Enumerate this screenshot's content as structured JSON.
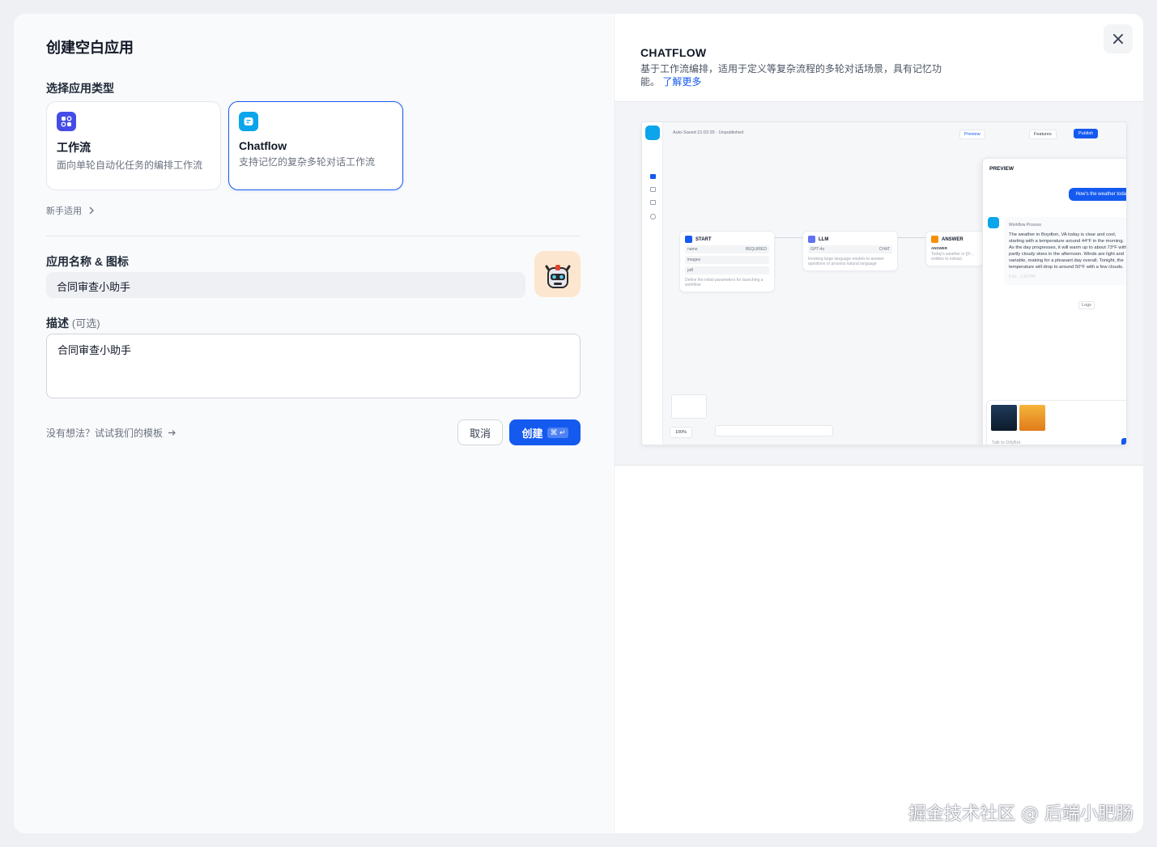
{
  "dialog": {
    "title": "创建空白应用",
    "app_type_label": "选择应用类型",
    "types": [
      {
        "name": "工作流",
        "desc": "面向单轮自动化任务的编排工作流",
        "icon": "workflow-icon",
        "color": "#444ce7"
      },
      {
        "name": "Chatflow",
        "desc": "支持记忆的复杂多轮对话工作流",
        "icon": "chatflow-icon",
        "color": "#0ba5ec"
      }
    ],
    "beginner_label": "新手适用",
    "name_icon_label": "应用名称 & 图标",
    "name_value": "合同审查小助手",
    "desc_label": "描述",
    "desc_optional": "(可选)",
    "desc_value": "合同审查小助手",
    "template_link": "没有想法？试试我们的模板",
    "cancel_label": "取消",
    "create_label": "创建",
    "create_kbd": "⌘ ↵",
    "accent": "#155aef"
  },
  "preview": {
    "title": "CHATFLOW",
    "desc": "基于工作流编排，适用于定义等复杂流程的多轮对话场景，具有记忆功能。",
    "learn_more": "了解更多",
    "screenshot": {
      "autosave": "Auto-Saved 21:02:35 · Unpublished",
      "preview_btn": "Preview",
      "features_btn": "Features",
      "publish_btn": "Publish",
      "nodes": [
        {
          "title": "START",
          "rows": [
            "name",
            "images",
            "pdf"
          ],
          "row_tag": "REQUIRED",
          "foot": "Define the initial parameters for launching a workflow"
        },
        {
          "title": "LLM",
          "model": "GPT-4o",
          "tag": "CHAT",
          "foot": "Invoking large language models to answer questions or process natural language"
        },
        {
          "title": "ANSWER",
          "label": "ANSWER",
          "foot": "Today's weather is {{#... entities to extract."
        }
      ],
      "zoom": "100%",
      "panel_title": "PREVIEW",
      "user_msg": "How's the weather today",
      "workflow_label": "Workflow Process",
      "answer": "The weather in Boydton, VA today is clear and cool, starting with a temperature around 44°F in the morning. As the day progresses, it will warm up to about 73°F with partly cloudy skies in the afternoon. Winds are light and variable, making for a pleasant day overall. Tonight, the temperature will drop to around 50°F with a few clouds.",
      "meta": "5.6s · 1:20 PM",
      "logs": "Logs",
      "input_placeholder": "Talk to DifyBot"
    }
  },
  "watermark": "掘金技术社区 @ 后端小肥肠"
}
